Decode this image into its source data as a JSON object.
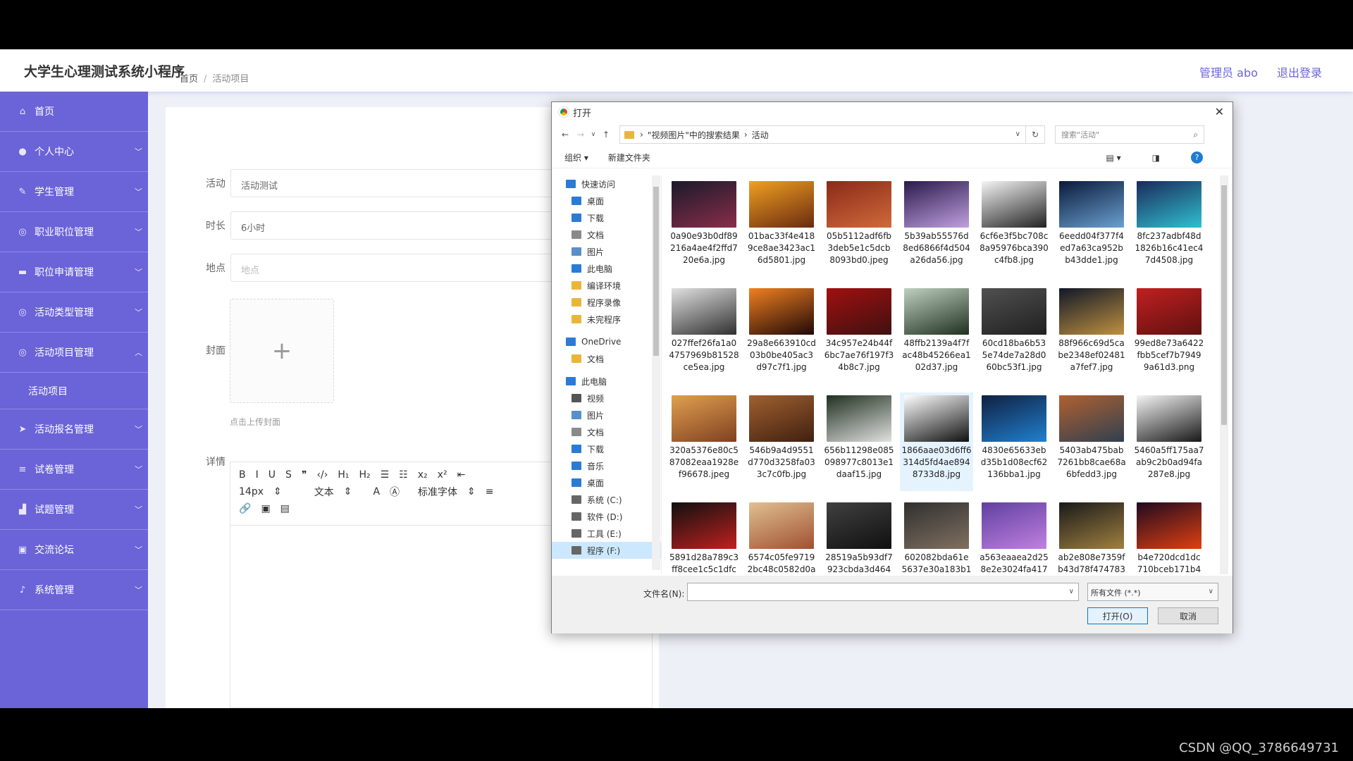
{
  "app": {
    "title": "大学生心理测试系统小程序",
    "user_label": "管理员 abo",
    "logout_label": "退出登录"
  },
  "sidebar": {
    "items": [
      {
        "label": "首页",
        "icon": "home-icon",
        "glyph": "⌂"
      },
      {
        "label": "个人中心",
        "icon": "user-icon",
        "glyph": "●"
      },
      {
        "label": "学生管理",
        "icon": "group-icon",
        "glyph": "✎"
      },
      {
        "label": "职业职位管理",
        "icon": "globe-icon",
        "glyph": "◎"
      },
      {
        "label": "职位申请管理",
        "icon": "monitor-icon",
        "glyph": "▬"
      },
      {
        "label": "活动类型管理",
        "icon": "compass-icon",
        "glyph": "◎"
      },
      {
        "label": "活动项目管理",
        "icon": "compass-icon",
        "glyph": "◎"
      },
      {
        "label": "活动项目",
        "sub": true
      },
      {
        "label": "活动报名管理",
        "icon": "send-icon",
        "glyph": "➤"
      },
      {
        "label": "试卷管理",
        "icon": "list-icon",
        "glyph": "≡"
      },
      {
        "label": "试题管理",
        "icon": "chart-icon",
        "glyph": "▟"
      },
      {
        "label": "交流论坛",
        "icon": "lock-icon",
        "glyph": "▣"
      },
      {
        "label": "系统管理",
        "icon": "mic-icon",
        "glyph": "♪"
      }
    ]
  },
  "breadcrumb": {
    "home": "首页",
    "separator": "/",
    "current": "活动项目"
  },
  "form": {
    "activity_label": "活动",
    "activity_value": "活动测试",
    "duration_label": "时长",
    "duration_value": "6小时",
    "location_label": "地点",
    "location_placeholder": "地点",
    "cover_label": "封面",
    "upload_plus": "+",
    "upload_hint": "点击上传封面",
    "detail_label": "详情"
  },
  "editor": {
    "row1": [
      "B",
      "I",
      "U",
      "S",
      "❞",
      "‹/›",
      "H₁",
      "H₂",
      "☰",
      "☷",
      "x₂",
      "x²",
      "⇤"
    ],
    "font_size": "14px",
    "block_type": "文本",
    "font_family": "标准字体",
    "row3": [
      "🔗",
      "▣",
      "▤"
    ]
  },
  "dialog": {
    "title": "打开",
    "close": "✕",
    "path": [
      "\"视频图片\"中的搜索结果",
      "活动"
    ],
    "search_placeholder": "搜索\"活动\"",
    "organize": "组织 ▾",
    "new_folder": "新建文件夹",
    "help": "?",
    "nav": [
      {
        "label": "快速访问",
        "indent": 0,
        "color": "#2b7bd6",
        "pin": false
      },
      {
        "label": "桌面",
        "indent": 1,
        "color": "#2b7bd6",
        "pin": true
      },
      {
        "label": "下载",
        "indent": 1,
        "color": "#2b7bd6",
        "pin": true
      },
      {
        "label": "文档",
        "indent": 1,
        "color": "#8a8a8a",
        "pin": true
      },
      {
        "label": "图片",
        "indent": 1,
        "color": "#5a8fc9",
        "pin": true
      },
      {
        "label": "此电脑",
        "indent": 1,
        "color": "#2b7bd6",
        "pin": true
      },
      {
        "label": "编译环境",
        "indent": 1,
        "color": "#e8b73a",
        "pin": false
      },
      {
        "label": "程序录像",
        "indent": 1,
        "color": "#e8b73a",
        "pin": false
      },
      {
        "label": "未完程序",
        "indent": 1,
        "color": "#e8b73a",
        "pin": false
      },
      {
        "label": "OneDrive",
        "indent": 0,
        "color": "#2b7bd6",
        "pin": false,
        "gap": true
      },
      {
        "label": "文档",
        "indent": 1,
        "color": "#e8b73a",
        "pin": false
      },
      {
        "label": "此电脑",
        "indent": 0,
        "color": "#2b7bd6",
        "pin": false,
        "gap": true
      },
      {
        "label": "视频",
        "indent": 1,
        "color": "#555",
        "pin": false
      },
      {
        "label": "图片",
        "indent": 1,
        "color": "#5a8fc9",
        "pin": false
      },
      {
        "label": "文档",
        "indent": 1,
        "color": "#8a8a8a",
        "pin": false
      },
      {
        "label": "下载",
        "indent": 1,
        "color": "#2b7bd6",
        "pin": false
      },
      {
        "label": "音乐",
        "indent": 1,
        "color": "#2b7bd6",
        "pin": false
      },
      {
        "label": "桌面",
        "indent": 1,
        "color": "#2b7bd6",
        "pin": false
      },
      {
        "label": "系统 (C:)",
        "indent": 1,
        "color": "#666",
        "pin": false
      },
      {
        "label": "软件 (D:)",
        "indent": 1,
        "color": "#666",
        "pin": false
      },
      {
        "label": "工具 (E:)",
        "indent": 1,
        "color": "#666",
        "pin": false
      },
      {
        "label": "程序 (F:)",
        "indent": 1,
        "color": "#666",
        "pin": false,
        "selected": true
      }
    ],
    "files": [
      {
        "lines": [
          "0a90e93b0df89",
          "216a4ae4f2ffd7",
          "20e6a.jpg"
        ],
        "colors": [
          "#1a1a2a",
          "#8a2d4a"
        ]
      },
      {
        "lines": [
          "01bac33f4e418",
          "9ce8ae3423ac1",
          "6d5801.jpg"
        ],
        "colors": [
          "#f0a020",
          "#6a2a10"
        ]
      },
      {
        "lines": [
          "05b5112adf6fb",
          "3deb5e1c5dcb",
          "8093bd0.jpeg"
        ],
        "colors": [
          "#8a2a1a",
          "#d06a3a"
        ]
      },
      {
        "lines": [
          "5b39ab55576d",
          "8ed6866f4d504",
          "a26da56.jpg"
        ],
        "colors": [
          "#2a1a4a",
          "#c0a0e0"
        ]
      },
      {
        "lines": [
          "6cf6e3f5bc708c",
          "8a95976bca390",
          "c4fb8.jpg"
        ],
        "colors": [
          "#f4f4f4",
          "#222222"
        ]
      },
      {
        "lines": [
          "6eedd04f377f4",
          "ed7a63ca952b",
          "b43dde1.jpg"
        ],
        "colors": [
          "#0a1a3a",
          "#6aa0d0"
        ]
      },
      {
        "lines": [
          "8fc237adbf48d",
          "1826b16c41ec4",
          "7d4508.jpg"
        ],
        "colors": [
          "#1a2a5a",
          "#30c0d0"
        ]
      },
      {
        "lines": [
          "027ffef26fa1a0",
          "4757969b81528",
          "ce5ea.jpg"
        ],
        "colors": [
          "#e0e0e0",
          "#303030"
        ]
      },
      {
        "lines": [
          "29a8e663910cd",
          "03b0be405ac3",
          "d97c7f1.jpg"
        ],
        "colors": [
          "#f08020",
          "#200808"
        ]
      },
      {
        "lines": [
          "34c957e24b44f",
          "6bc7ae76f197f3",
          "4b8c7.jpg"
        ],
        "colors": [
          "#a01010",
          "#401010"
        ]
      },
      {
        "lines": [
          "48ffb2139a4f7f",
          "ac48b45266ea1",
          "02d37.jpg"
        ],
        "colors": [
          "#c0d0c0",
          "#203020"
        ]
      },
      {
        "lines": [
          "60cd18ba6b53",
          "5e74de7a28d0",
          "60bc53f1.jpg"
        ],
        "colors": [
          "#505050",
          "#202020"
        ]
      },
      {
        "lines": [
          "88f966c69d5ca",
          "be2348ef02481",
          "a7fef7.jpg"
        ],
        "colors": [
          "#101828",
          "#c09040"
        ]
      },
      {
        "lines": [
          "99ed8e73a6422",
          "fbb5cef7b7949",
          "9a61d3.png"
        ],
        "colors": [
          "#c02020",
          "#601010"
        ]
      },
      {
        "lines": [
          "320a5376e80c5",
          "87082eaa1928e",
          "f96678.jpeg"
        ],
        "colors": [
          "#e0a050",
          "#804020"
        ]
      },
      {
        "lines": [
          "546b9a4d9551",
          "d770d3258fa03",
          "3c7c0fb.jpg"
        ],
        "colors": [
          "#a06030",
          "#402010"
        ]
      },
      {
        "lines": [
          "656b11298e085",
          "098977c8013e1",
          "daaf15.jpg"
        ],
        "colors": [
          "#203020",
          "#e0e0e0"
        ]
      },
      {
        "lines": [
          "1866aae03d6ff6",
          "314d5fd4ae894",
          "8733d8.jpg"
        ],
        "colors": [
          "#ffffff",
          "#101010"
        ],
        "highlight": true
      },
      {
        "lines": [
          "4830e65633eb",
          "d35b1d08ecf62",
          "136bba1.jpg"
        ],
        "colors": [
          "#102040",
          "#2080d0"
        ]
      },
      {
        "lines": [
          "5403ab475bab",
          "7261bb8cae68a",
          "6bfedd3.jpg"
        ],
        "colors": [
          "#b06030",
          "#304050"
        ]
      },
      {
        "lines": [
          "5460a5ff175aa7",
          "ab9c2b0ad94fa",
          "287e8.jpg"
        ],
        "colors": [
          "#f4f4f4",
          "#181818"
        ]
      },
      {
        "lines": [
          "5891d28a789c3",
          "ff8cee1c5c1dfc"
        ],
        "colors": [
          "#101010",
          "#c02020"
        ]
      },
      {
        "lines": [
          "6574c05fe9719",
          "2bc48c0582d0a"
        ],
        "colors": [
          "#e0c090",
          "#a05030"
        ]
      },
      {
        "lines": [
          "28519a5b93df7",
          "923cbda3d464"
        ],
        "colors": [
          "#404040",
          "#101010"
        ]
      },
      {
        "lines": [
          "602082bda61e",
          "5637e30a183b1"
        ],
        "colors": [
          "#303030",
          "#807060"
        ]
      },
      {
        "lines": [
          "a563eaaea2d25",
          "8e2e3024fa417"
        ],
        "colors": [
          "#6040a0",
          "#c080e0"
        ]
      },
      {
        "lines": [
          "ab2e808e7359f",
          "b43d78f474783"
        ],
        "colors": [
          "#1a1a1a",
          "#a08040"
        ]
      },
      {
        "lines": [
          "b4e720dcd1dc",
          "710bceb171b4"
        ],
        "colors": [
          "#200a20",
          "#e04010"
        ]
      }
    ],
    "filename_label": "文件名(N):",
    "filetype": "所有文件 (*.*)",
    "open_button": "打开(O)",
    "cancel_button": "取消"
  },
  "watermark": "CSDN @QQ_3786649731"
}
